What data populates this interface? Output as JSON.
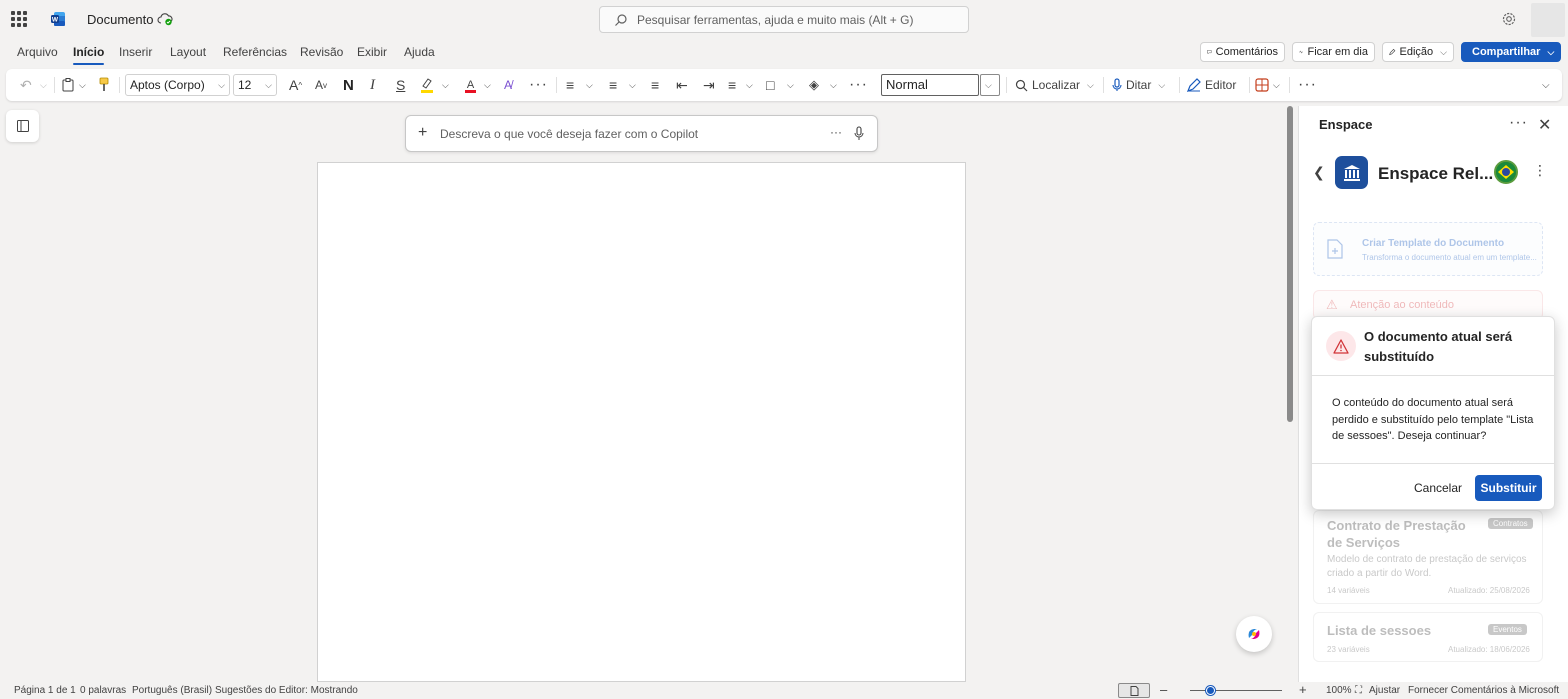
{
  "titlebar": {
    "doc_title": "Documento",
    "search_placeholder": "Pesquisar ferramentas, ajuda e muito mais (Alt + G)"
  },
  "menu": {
    "tabs": [
      "Arquivo",
      "Início",
      "Inserir",
      "Layout",
      "Referências",
      "Revisão",
      "Exibir",
      "Ajuda"
    ],
    "active_tab": "Início",
    "comments_label": "Comentários",
    "catchup_label": "Ficar em dia",
    "editing_label": "Edição",
    "share_label": "Compartilhar"
  },
  "ribbon": {
    "font_name": "Aptos (Corpo)",
    "font_size": "12",
    "bold_glyph": "N",
    "italic_glyph": "I",
    "strike_glyph": "S",
    "style_value": "Normal",
    "find_label": "Localizar",
    "dictate_label": "Ditar",
    "editor_label": "Editor"
  },
  "copilot": {
    "placeholder": "Descreva o que você deseja fazer com o Copilot"
  },
  "pane": {
    "title": "Enspace",
    "addin_name": "Enspace Rel...",
    "create_template_title": "Criar Template do Documento",
    "create_template_desc": "Transforma o documento atual em um template...",
    "warning_title": "Atenção ao conteúdo",
    "cards": [
      {
        "title": "Contrato de Prestação de Serviços",
        "badge": "Contratos",
        "desc": "Modelo de contrato de prestação de serviços criado a partir do Word.",
        "vars": "14 variáveis",
        "updated": "Atualizado: 25/08/2026"
      },
      {
        "title": "Lista de sessoes",
        "badge": "Eventos",
        "vars": "23 variáveis",
        "updated": "Atualizado: 18/06/2026"
      }
    ]
  },
  "dialog": {
    "title": "O documento atual será substituído",
    "body": "O conteúdo do documento atual será perdido e substituído pelo template \"Lista de sessoes\". Deseja continuar?",
    "cancel_label": "Cancelar",
    "confirm_label": "Substituir"
  },
  "status": {
    "page": "Página 1 de 1",
    "words": "0 palavras",
    "language": "Português (Brasil)",
    "editor_suggestions": "Sugestões do Editor: Mostrando",
    "zoom": "100%",
    "fit_label": "Ajustar",
    "feedback": "Fornecer Comentários à Microsoft"
  },
  "colors": {
    "accent": "#185abd",
    "warning": "#d13438",
    "addin_logo": "#1e4f9c"
  }
}
